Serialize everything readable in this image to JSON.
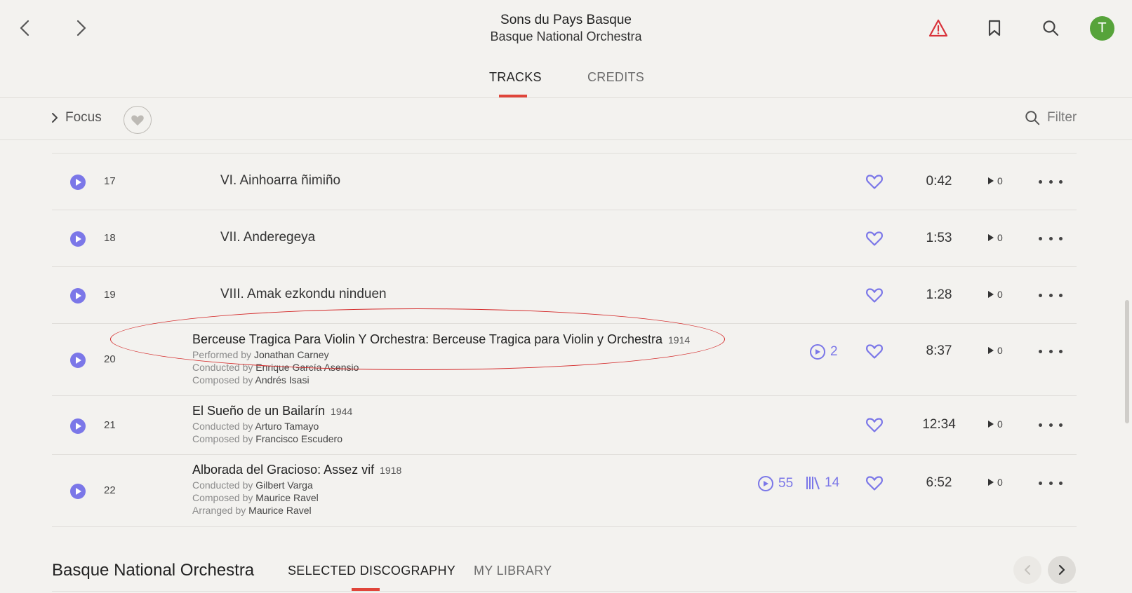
{
  "header": {
    "album_title": "Sons du Pays Basque",
    "album_artist": "Basque National Orchestra",
    "avatar_letter": "T",
    "tabs": [
      "TRACKS",
      "CREDITS"
    ]
  },
  "toolbar": {
    "focus_label": "Focus",
    "filter_label": "Filter"
  },
  "tracks": [
    {
      "num": "17",
      "title": "VI. Ainhoarra ñimiño",
      "duration": "0:42",
      "plays": "0"
    },
    {
      "num": "18",
      "title": "VII. Anderegeya",
      "duration": "1:53",
      "plays": "0"
    },
    {
      "num": "19",
      "title": "VIII. Amak ezkondu ninduen",
      "duration": "1:28",
      "plays": "0"
    },
    {
      "num": "20",
      "title": "Berceuse Tragica Para Violin Y Orchestra: Berceuse Tragica para Violin  y Orchestra",
      "year": "1914",
      "credits": [
        {
          "role": "Performed by",
          "name": "Jonathan Carney"
        },
        {
          "role": "Conducted by",
          "name": "Enrique García Asensio"
        },
        {
          "role": "Composed by",
          "name": "Andrés Isasi"
        }
      ],
      "recordings": "2",
      "duration": "8:37",
      "plays": "0"
    },
    {
      "num": "21",
      "title": "El Sueño de un Bailarín",
      "year": "1944",
      "credits": [
        {
          "role": "Conducted by",
          "name": "Arturo Tamayo"
        },
        {
          "role": "Composed by",
          "name": "Francisco Escudero"
        }
      ],
      "duration": "12:34",
      "plays": "0"
    },
    {
      "num": "22",
      "title": "Alborada del Gracioso: Assez vif",
      "year": "1918",
      "credits": [
        {
          "role": "Conducted by",
          "name": "Gilbert Varga"
        },
        {
          "role": "Composed by",
          "name": "Maurice Ravel"
        },
        {
          "role": "Arranged by",
          "name": "Maurice Ravel"
        }
      ],
      "recordings": "55",
      "library": "14",
      "duration": "6:52",
      "plays": "0"
    }
  ],
  "bottom": {
    "title": "Basque National Orchestra",
    "tabs": [
      "SELECTED DISCOGRAPHY",
      "MY LIBRARY"
    ]
  },
  "colors": {
    "accent_purple": "#7b77e8",
    "accent_red": "#e0453a",
    "avatar_green": "#56a33a",
    "annotation_red": "#d42a2a"
  },
  "icons": [
    "chevron-left-icon",
    "chevron-right-icon",
    "warning-icon",
    "bookmark-icon",
    "search-icon",
    "heart-icon",
    "play-icon",
    "more-icon",
    "recordings-icon",
    "library-icon"
  ]
}
